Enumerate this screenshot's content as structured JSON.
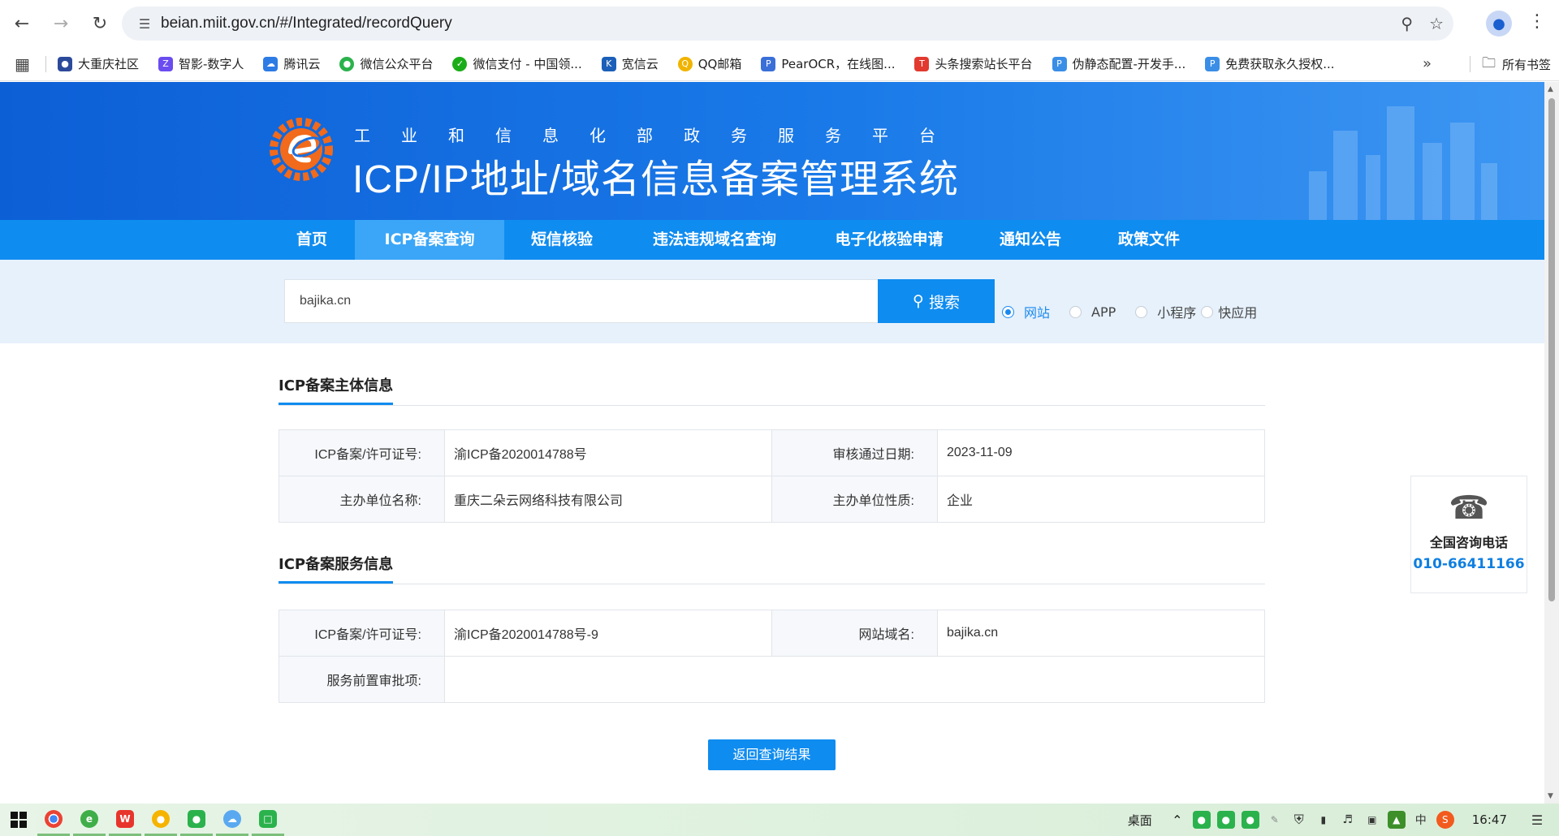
{
  "browser": {
    "url": "beian.miit.gov.cn/#/Integrated/recordQuery",
    "bookmarks": [
      {
        "label": "大重庆社区",
        "color": "#2b4a9a"
      },
      {
        "label": "智影-数字人",
        "color": "#6b4cf0"
      },
      {
        "label": "腾讯云",
        "color": "#2d7be5"
      },
      {
        "label": "微信公众平台",
        "color": "#2bb24c"
      },
      {
        "label": "微信支付 - 中国领...",
        "color": "#1aad19"
      },
      {
        "label": "宽信云",
        "color": "#1b5fb8"
      },
      {
        "label": "QQ邮箱",
        "color": "#f0b400"
      },
      {
        "label": "PearOCR，在线图...",
        "color": "#3a6fd8"
      },
      {
        "label": "头条搜索站长平台",
        "color": "#e23a2e"
      },
      {
        "label": "伪静态配置-开发手...",
        "color": "#3a8ee6"
      },
      {
        "label": "免费获取永久授权...",
        "color": "#3a8ee6"
      }
    ],
    "all_bookmarks": "所有书签"
  },
  "header": {
    "subtitle": "工业和信息化部政务服务平台",
    "title": "ICP/IP地址/域名信息备案管理系统"
  },
  "menu": [
    {
      "label": "首页"
    },
    {
      "label": "ICP备案查询"
    },
    {
      "label": "短信核验"
    },
    {
      "label": "违法违规域名查询"
    },
    {
      "label": "电子化核验申请"
    },
    {
      "label": "通知公告"
    },
    {
      "label": "政策文件"
    }
  ],
  "search": {
    "value": "bajika.cn",
    "button": "搜索",
    "options": [
      "网站",
      "APP",
      "小程序",
      "快应用"
    ],
    "selected": "网站"
  },
  "subject": {
    "title": "ICP备案主体信息",
    "rows": [
      {
        "k1": "ICP备案/许可证号:",
        "v1": "渝ICP备2020014788号",
        "k2": "审核通过日期:",
        "v2": "2023-11-09"
      },
      {
        "k1": "主办单位名称:",
        "v1": "重庆二朵云网络科技有限公司",
        "k2": "主办单位性质:",
        "v2": "企业"
      }
    ]
  },
  "service": {
    "title": "ICP备案服务信息",
    "rows": [
      {
        "k1": "ICP备案/许可证号:",
        "v1": "渝ICP备2020014788号-9",
        "k2": "网站域名:",
        "v2": "bajika.cn"
      },
      {
        "k1": "服务前置审批项:",
        "v1": ""
      }
    ]
  },
  "back_button": "返回查询结果",
  "consult": {
    "label": "全国咨询电话",
    "phone": "010-66411166"
  },
  "taskbar": {
    "desktop": "桌面",
    "ime": "中",
    "time": "16:47"
  }
}
